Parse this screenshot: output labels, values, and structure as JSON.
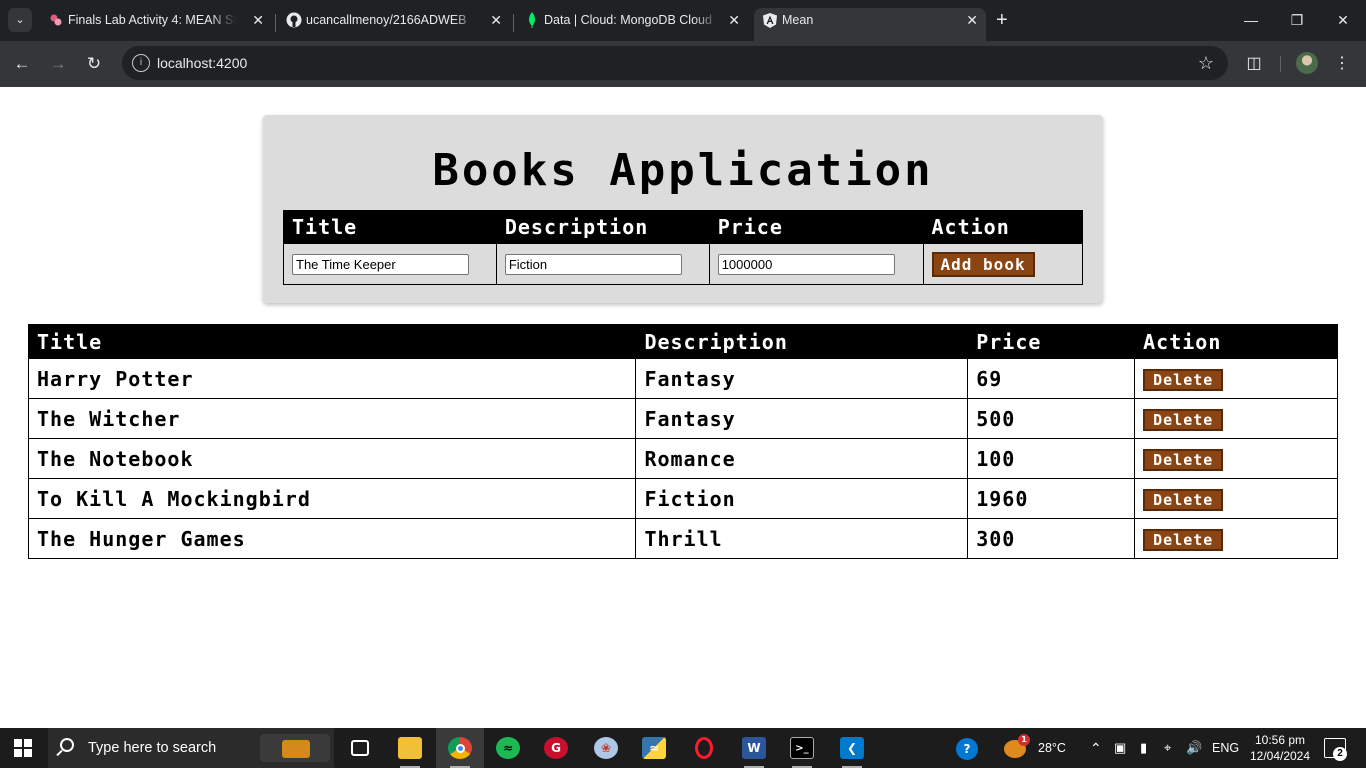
{
  "browser": {
    "tabs": [
      {
        "title": "Finals Lab Activity 4: MEAN Stac",
        "icon": "pinwheel-icon"
      },
      {
        "title": "ucancallmenoy/2166ADWEB",
        "icon": "github-icon"
      },
      {
        "title": "Data | Cloud: MongoDB Cloud",
        "icon": "mongodb-leaf-icon"
      },
      {
        "title": "Mean",
        "icon": "angular-icon",
        "active": true
      }
    ],
    "url": "localhost:4200"
  },
  "app": {
    "title": "Books Application",
    "form": {
      "headers": [
        "Title",
        "Description",
        "Price",
        "Action"
      ],
      "title_value": "The Time Keeper",
      "description_value": "Fiction",
      "price_value": "1000000",
      "add_button": "Add book"
    },
    "books": {
      "headers": [
        "Title",
        "Description",
        "Price",
        "Action"
      ],
      "rows": [
        {
          "title": "Harry Potter",
          "description": "Fantasy",
          "price": "69",
          "action": "Delete"
        },
        {
          "title": "The Witcher",
          "description": "Fantasy",
          "price": "500",
          "action": "Delete"
        },
        {
          "title": "The Notebook",
          "description": "Romance",
          "price": "100",
          "action": "Delete"
        },
        {
          "title": "To Kill A Mockingbird",
          "description": "Fiction",
          "price": "1960",
          "action": "Delete"
        },
        {
          "title": "The Hunger Games",
          "description": "Thrill",
          "price": "300",
          "action": "Delete"
        }
      ]
    }
  },
  "taskbar": {
    "search_placeholder": "Type here to search",
    "weather": "28°C",
    "language": "ENG",
    "time": "10:56 pm",
    "date": "12/04/2024",
    "notification_count": "2",
    "weather_badge": "1"
  },
  "colors": {
    "button_bg": "#8b4513",
    "header_bg": "#000000",
    "card_bg": "#dcdcdc"
  }
}
